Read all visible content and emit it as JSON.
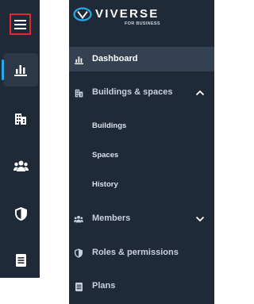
{
  "brand": {
    "name": "VIVERSE",
    "tagline": "FOR BUSINESS",
    "accent": "#29a9e6",
    "highlight": "#e4272f"
  },
  "rail": {
    "menu_icon": "hamburger-icon",
    "items": [
      {
        "icon": "bar-chart-icon",
        "active": true
      },
      {
        "icon": "building-icon",
        "active": false
      },
      {
        "icon": "people-icon",
        "active": false
      },
      {
        "icon": "shield-icon",
        "active": false
      },
      {
        "icon": "document-icon",
        "active": false
      }
    ]
  },
  "nav": {
    "dashboard": "Dashboard",
    "buildings_spaces": "Buildings & spaces",
    "buildings": "Buildings",
    "spaces": "Spaces",
    "history": "History",
    "members": "Members",
    "roles": "Roles & permissions",
    "plans": "Plans"
  }
}
